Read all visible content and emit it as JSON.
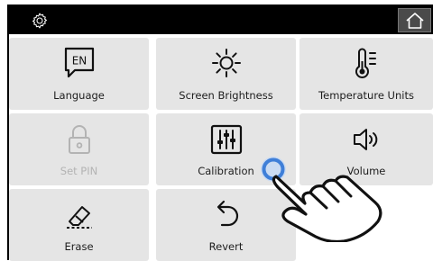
{
  "topbar": {
    "settings_icon": "gear-icon",
    "home_icon": "home-icon"
  },
  "tiles": [
    {
      "label": "Language",
      "icon": "en-speech-bubble-icon",
      "enabled": true
    },
    {
      "label": "Screen Brightness",
      "icon": "sun-icon",
      "enabled": true
    },
    {
      "label": "Temperature Units",
      "icon": "thermometer-icon",
      "enabled": true
    },
    {
      "label": "Set PIN",
      "icon": "lock-icon",
      "enabled": false
    },
    {
      "label": "Calibration",
      "icon": "sliders-icon",
      "enabled": true
    },
    {
      "label": "Volume",
      "icon": "speaker-icon",
      "enabled": true
    },
    {
      "label": "Erase",
      "icon": "eraser-icon",
      "enabled": true
    },
    {
      "label": "Revert",
      "icon": "undo-arrow-icon",
      "enabled": true
    }
  ],
  "language_icon_text": "EN",
  "colors": {
    "topbar": "#000000",
    "tile": "#e5e5e5",
    "disabled": "#b3b3b3",
    "touch_indicator": "#3f7fd8"
  }
}
